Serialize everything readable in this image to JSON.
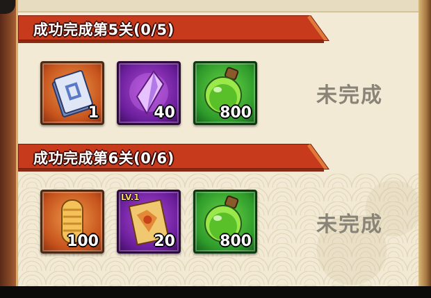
{
  "tasks": [
    {
      "title": "成功完成第5关(0/5)",
      "status": "未完成",
      "rewards": [
        {
          "icon": "ticket-icon",
          "qty": "1"
        },
        {
          "icon": "purple-crystal-icon",
          "qty": "40"
        },
        {
          "icon": "green-potion-icon",
          "qty": "800"
        }
      ]
    },
    {
      "title": "成功完成第6关(0/6)",
      "status": "未完成",
      "rewards": [
        {
          "icon": "gold-scroll-icon",
          "qty": "100"
        },
        {
          "icon": "skill-scroll-icon",
          "qty": "20",
          "level": "LV.1"
        },
        {
          "icon": "green-potion-icon",
          "qty": "800"
        }
      ]
    }
  ],
  "colors": {
    "banner_red": "#c83a1c",
    "panel_bg": "#f2ead5",
    "status_text": "#8a8478"
  }
}
